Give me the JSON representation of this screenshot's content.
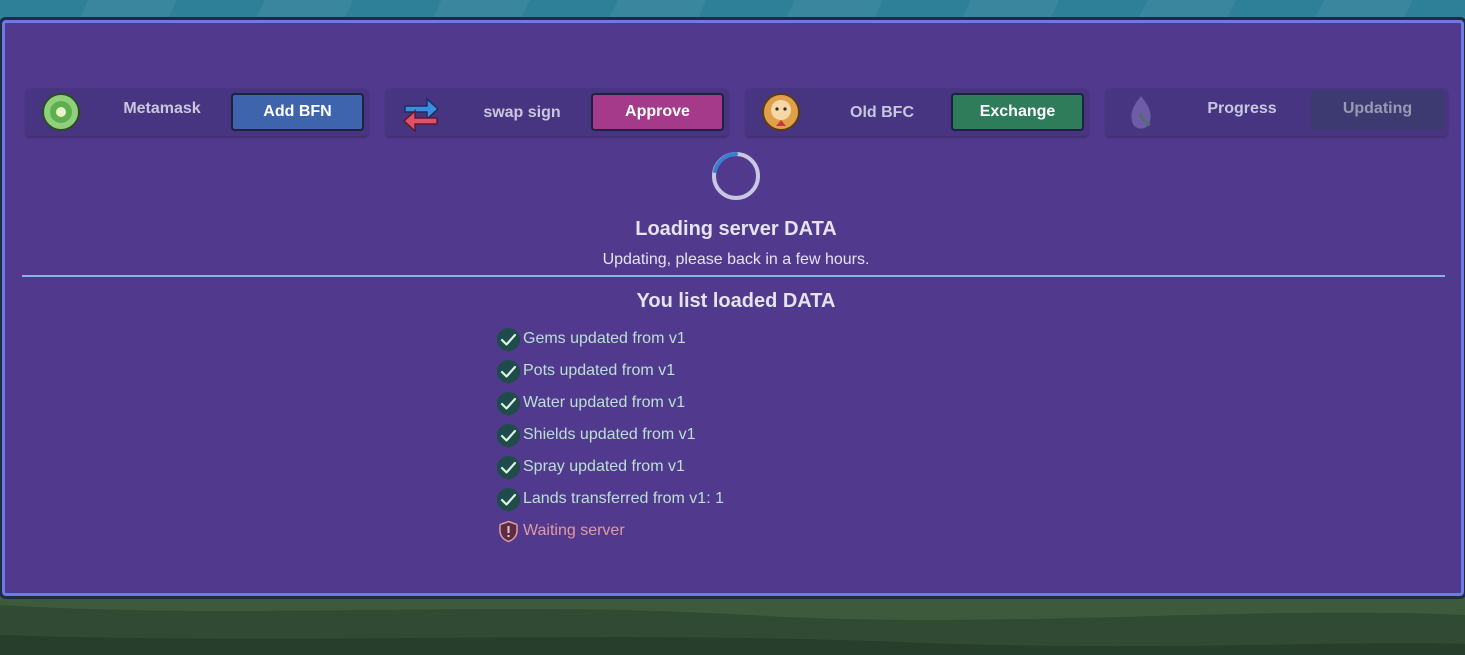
{
  "cards": [
    {
      "icon": "metamask-flower-icon",
      "label": "Metamask",
      "button": "Add BFN",
      "button_style": "blue"
    },
    {
      "icon": "swap-arrows-icon",
      "label": "swap sign",
      "button": "Approve",
      "button_style": "pink"
    },
    {
      "icon": "sunflower-character-icon",
      "label": "Old BFC",
      "button": "Exchange",
      "button_style": "green"
    },
    {
      "icon": "seed-sprout-icon",
      "label": "Progress",
      "button": "Updating",
      "button_style": "disabled"
    }
  ],
  "loading": {
    "title": "Loading server DATA",
    "subtitle": "Updating, please back in a few hours."
  },
  "list": {
    "title": "You list loaded DATA",
    "items": [
      {
        "status": "done",
        "text": "Gems updated from v1"
      },
      {
        "status": "done",
        "text": "Pots updated from v1"
      },
      {
        "status": "done",
        "text": "Water updated from v1"
      },
      {
        "status": "done",
        "text": "Shields updated from v1"
      },
      {
        "status": "done",
        "text": "Spray updated from v1"
      },
      {
        "status": "done",
        "text": "Lands transferred from v1: 1"
      },
      {
        "status": "waiting",
        "text": "Waiting server"
      }
    ]
  },
  "colors": {
    "panel": "#51398d",
    "panel_border": "#6f79e2",
    "btn_blue": "#3d64ad",
    "btn_pink": "#a5398a",
    "btn_green": "#2f7c5b",
    "done_text": "#b8e1d3",
    "waiting_text": "#e29b9e"
  }
}
